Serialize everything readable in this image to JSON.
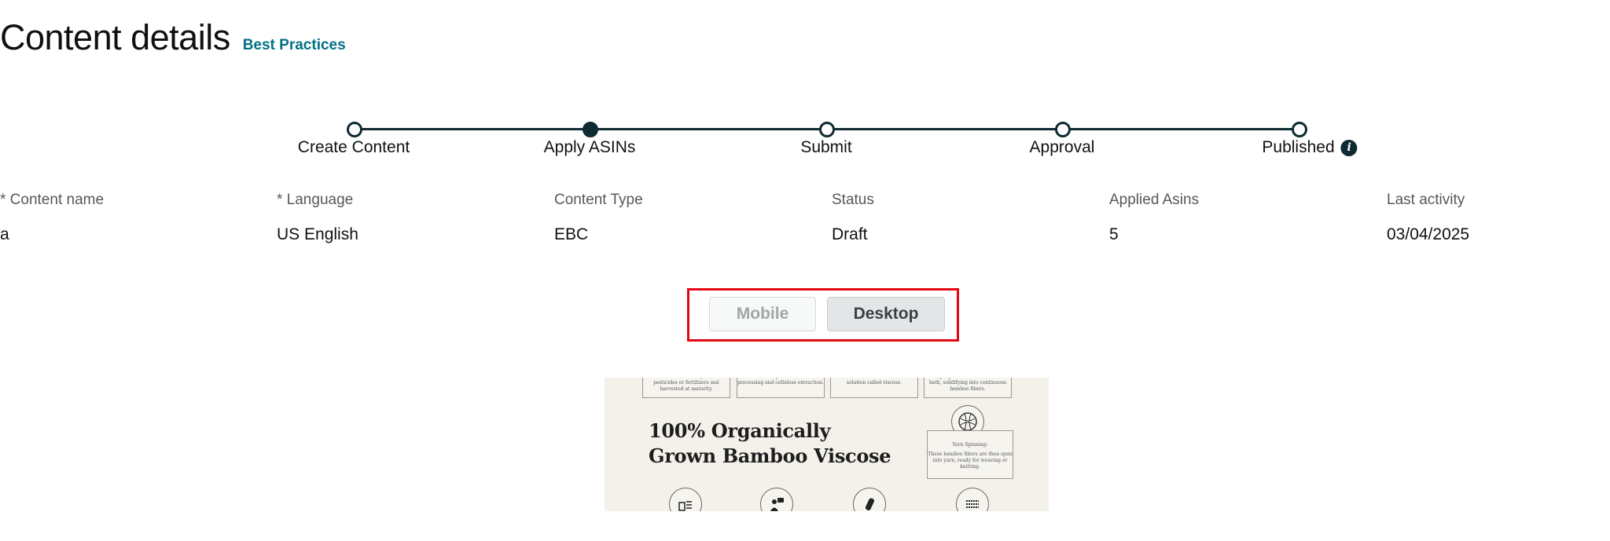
{
  "header": {
    "title": "Content details",
    "link": "Best Practices"
  },
  "stepper": {
    "steps": [
      {
        "label": "Create Content",
        "active": false
      },
      {
        "label": "Apply ASINs",
        "active": true
      },
      {
        "label": "Submit",
        "active": false
      },
      {
        "label": "Approval",
        "active": false
      },
      {
        "label": "Published",
        "active": false,
        "has_info": true
      }
    ]
  },
  "details": {
    "columns": [
      {
        "label": "* Content name",
        "value": "a"
      },
      {
        "label": "* Language",
        "value": "US English"
      },
      {
        "label": "Content Type",
        "value": "EBC"
      },
      {
        "label": "Status",
        "value": "Draft"
      },
      {
        "label": "Applied Asins",
        "value": "5"
      },
      {
        "label": "Last activity",
        "value": "03/04/2025"
      }
    ]
  },
  "view_toggle": {
    "mobile_label": "Mobile",
    "desktop_label": "Desktop",
    "selected": "Desktop"
  },
  "preview": {
    "heading_line1": "100% Organically",
    "heading_line2": "Grown Bamboo Viscose",
    "box1_text": "cultivated without synthetic pesticides or fertilizers and harvested at maturity.",
    "box2_text": "into smaller pieces for easier processing and cellulose extraction.",
    "box3_text": "with chemicals to create a viscose solution called viscose.",
    "box4_text": "through spinnerets into a chemical bath, solidifying into continuous bamboo fibers.",
    "yarn_title": "Yarn Spinning:",
    "yarn_text": "These bamboo fibers are then spun into yarn, ready for weaving or knitting."
  }
}
